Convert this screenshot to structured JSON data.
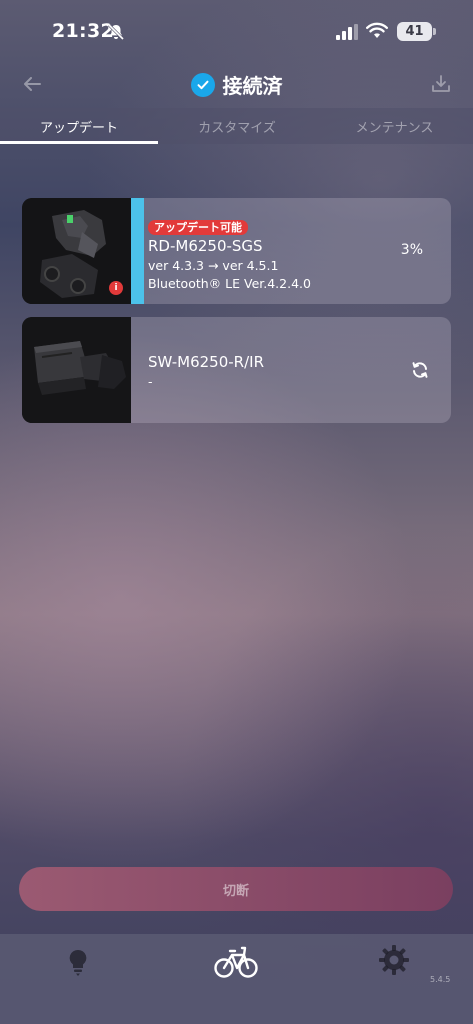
{
  "status_bar": {
    "time": "21:32",
    "battery": "41"
  },
  "header": {
    "title": "接続済"
  },
  "tabs": [
    {
      "label": "アップデート",
      "active": true
    },
    {
      "label": "カスタマイズ",
      "active": false
    },
    {
      "label": "メンテナンス",
      "active": false
    }
  ],
  "devices": [
    {
      "badge": "アップデート可能",
      "model": "RD-M6250-SGS",
      "version_line": "ver 4.3.3 → ver 4.5.1",
      "bluetooth_line": "Bluetooth® LE Ver.4.2.4.0",
      "progress_text": "3%",
      "accent_color": "#4cc2ea"
    },
    {
      "model": "SW-M6250-R/IR",
      "sub_line": "-",
      "status_icon": "refresh-icon"
    }
  ],
  "disconnect_label": "切断",
  "bottom_nav": {
    "icons": [
      "bulb-icon",
      "bike-icon",
      "gear-icon"
    ],
    "version": "5.4.5"
  }
}
